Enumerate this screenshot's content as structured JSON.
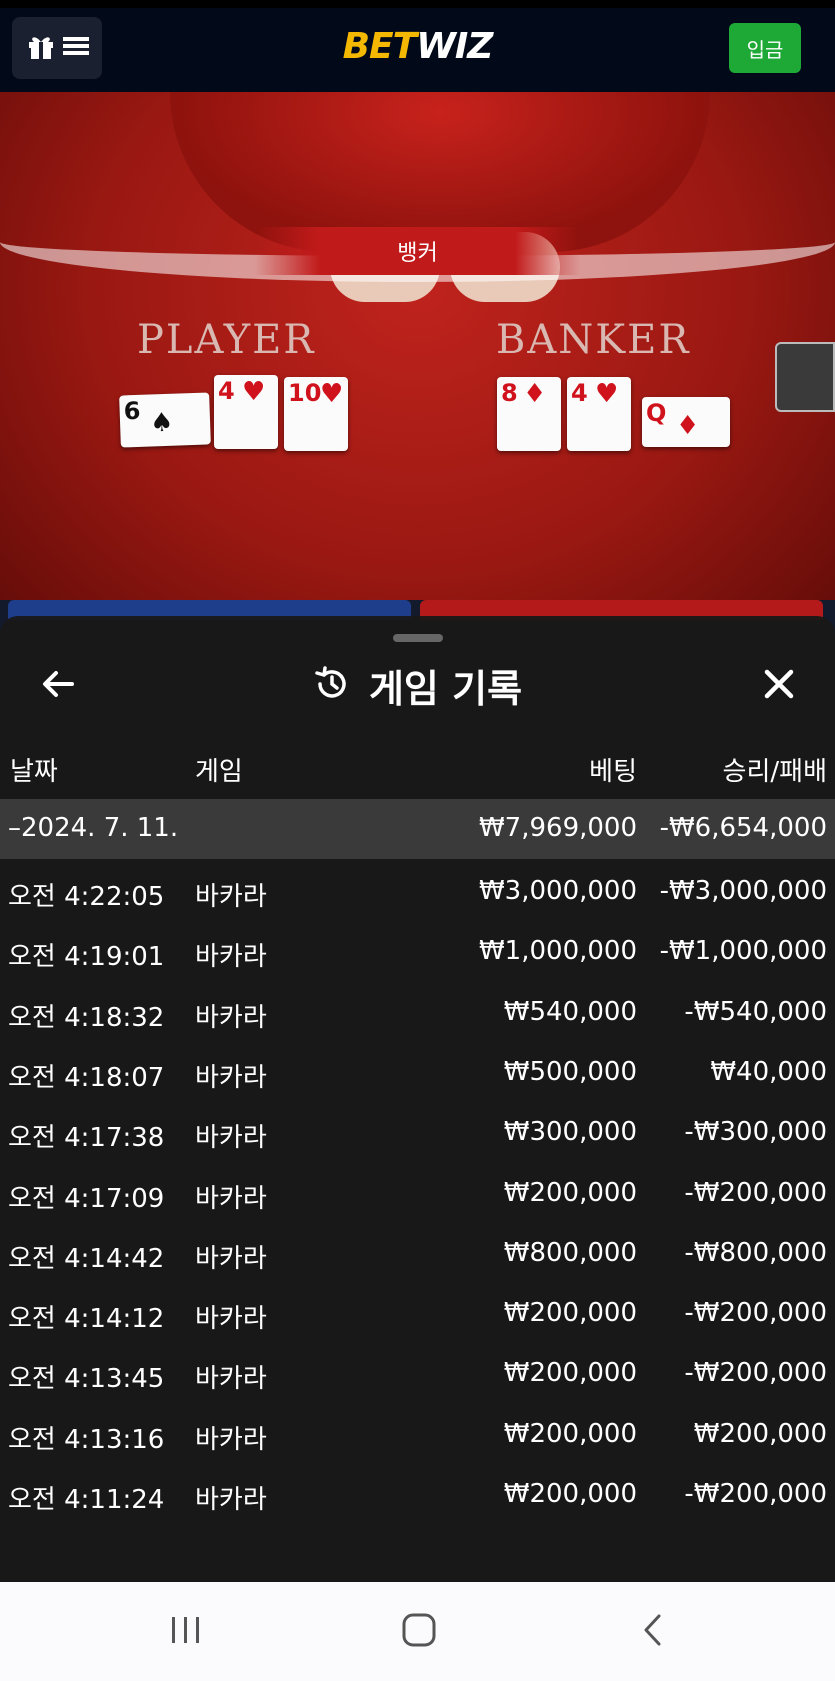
{
  "app": {
    "logo_part1": "BET",
    "logo_part2": "WIZ",
    "deposit_label": "입금",
    "accent_color": "#1ea835",
    "brand_color": "#f5b800"
  },
  "game_view": {
    "result_banner": "뱅커",
    "player_label": "PLAYER",
    "banker_label": "BANKER",
    "player_cards": [
      {
        "rank": "6",
        "suit": "♠"
      },
      {
        "rank": "4",
        "suit": "♥"
      },
      {
        "rank": "10",
        "suit": "♥"
      }
    ],
    "banker_cards": [
      {
        "rank": "8",
        "suit": "♦"
      },
      {
        "rank": "4",
        "suit": "♥"
      },
      {
        "rank": "Q",
        "suit": "♦"
      }
    ]
  },
  "history": {
    "title": "게임 기록",
    "icons": {
      "back": "arrow-left-icon",
      "close": "close-icon",
      "title": "history-icon"
    },
    "columns": {
      "date": "날짜",
      "game": "게임",
      "bet": "베팅",
      "result": "승리/패배"
    },
    "group": {
      "date": "–2024. 7. 11.",
      "bet_total": "₩7,969,000",
      "result_total": "-₩6,654,000"
    },
    "rows": [
      {
        "time": "오전 4:22:05",
        "game": "바카라",
        "bet": "₩3,000,000",
        "result": "-₩3,000,000"
      },
      {
        "time": "오전 4:19:01",
        "game": "바카라",
        "bet": "₩1,000,000",
        "result": "-₩1,000,000"
      },
      {
        "time": "오전 4:18:32",
        "game": "바카라",
        "bet": "₩540,000",
        "result": "-₩540,000"
      },
      {
        "time": "오전 4:18:07",
        "game": "바카라",
        "bet": "₩500,000",
        "result": "₩40,000"
      },
      {
        "time": "오전 4:17:38",
        "game": "바카라",
        "bet": "₩300,000",
        "result": "-₩300,000"
      },
      {
        "time": "오전 4:17:09",
        "game": "바카라",
        "bet": "₩200,000",
        "result": "-₩200,000"
      },
      {
        "time": "오전 4:14:42",
        "game": "바카라",
        "bet": "₩800,000",
        "result": "-₩800,000"
      },
      {
        "time": "오전 4:14:12",
        "game": "바카라",
        "bet": "₩200,000",
        "result": "-₩200,000"
      },
      {
        "time": "오전 4:13:45",
        "game": "바카라",
        "bet": "₩200,000",
        "result": "-₩200,000"
      },
      {
        "time": "오전 4:13:16",
        "game": "바카라",
        "bet": "₩200,000",
        "result": "₩200,000"
      },
      {
        "time": "오전 4:11:24",
        "game": "바카라",
        "bet": "₩200,000",
        "result": "-₩200,000"
      }
    ]
  },
  "system_nav": {
    "icons": [
      "recent-apps-icon",
      "home-icon",
      "back-icon"
    ]
  }
}
